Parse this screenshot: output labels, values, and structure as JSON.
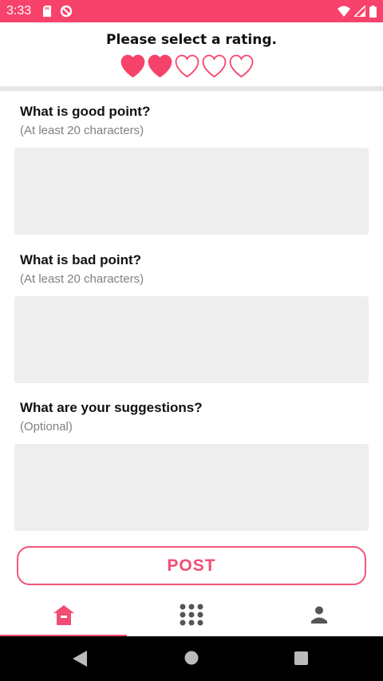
{
  "status_bar": {
    "time": "3:33",
    "left_icons": [
      "sd-card-icon",
      "sync-disabled-icon"
    ],
    "right_icons": [
      "wifi-icon",
      "signal-icon",
      "battery-icon"
    ]
  },
  "rating": {
    "title": "Please select a rating.",
    "value": 2,
    "max": 5,
    "accent_color": "#f7426b"
  },
  "questions": [
    {
      "title": "What is good point?",
      "subtitle": "(At least 20 characters)",
      "value": ""
    },
    {
      "title": "What is bad point?",
      "subtitle": "(At least 20 characters)",
      "value": ""
    },
    {
      "title": "What are your suggestions?",
      "subtitle": "(Optional)",
      "value": ""
    }
  ],
  "post_label": "POST",
  "bottom_nav": {
    "items": [
      {
        "icon": "home-icon",
        "active": true
      },
      {
        "icon": "grid-icon",
        "active": false
      },
      {
        "icon": "person-icon",
        "active": false
      }
    ]
  },
  "system_nav": [
    "back-icon",
    "home-circle-icon",
    "recents-icon"
  ]
}
